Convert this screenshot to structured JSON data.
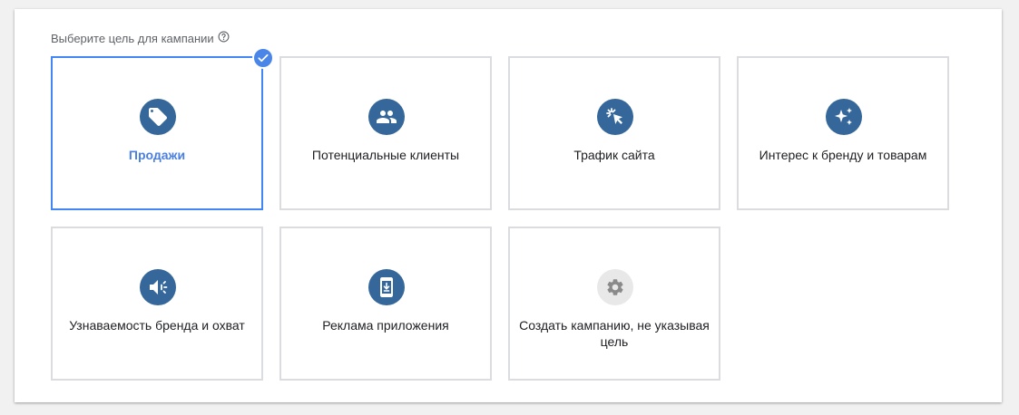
{
  "heading": {
    "text": "Выберите цель для кампании",
    "help_icon": "help-circle-icon"
  },
  "goals": [
    {
      "label": "Продажи",
      "icon": "tag-icon",
      "selected": true
    },
    {
      "label": "Потенциальные клиенты",
      "icon": "people-icon",
      "selected": false
    },
    {
      "label": "Трафик сайта",
      "icon": "cursor-click-icon",
      "selected": false
    },
    {
      "label": "Интерес к бренду и товарам",
      "icon": "sparkle-icon",
      "selected": false
    },
    {
      "label": "Узнаваемость бренда и охват",
      "icon": "megaphone-icon",
      "selected": false
    },
    {
      "label": "Реклама приложения",
      "icon": "mobile-download-icon",
      "selected": false
    },
    {
      "label": "Создать кампанию, не указывая цель",
      "icon": "gear-icon",
      "selected": false
    }
  ],
  "colors": {
    "accent": "#4285f4",
    "icon_background": "#35679a",
    "card_border": "#dadce0",
    "selected_label": "#4a7fe0"
  }
}
